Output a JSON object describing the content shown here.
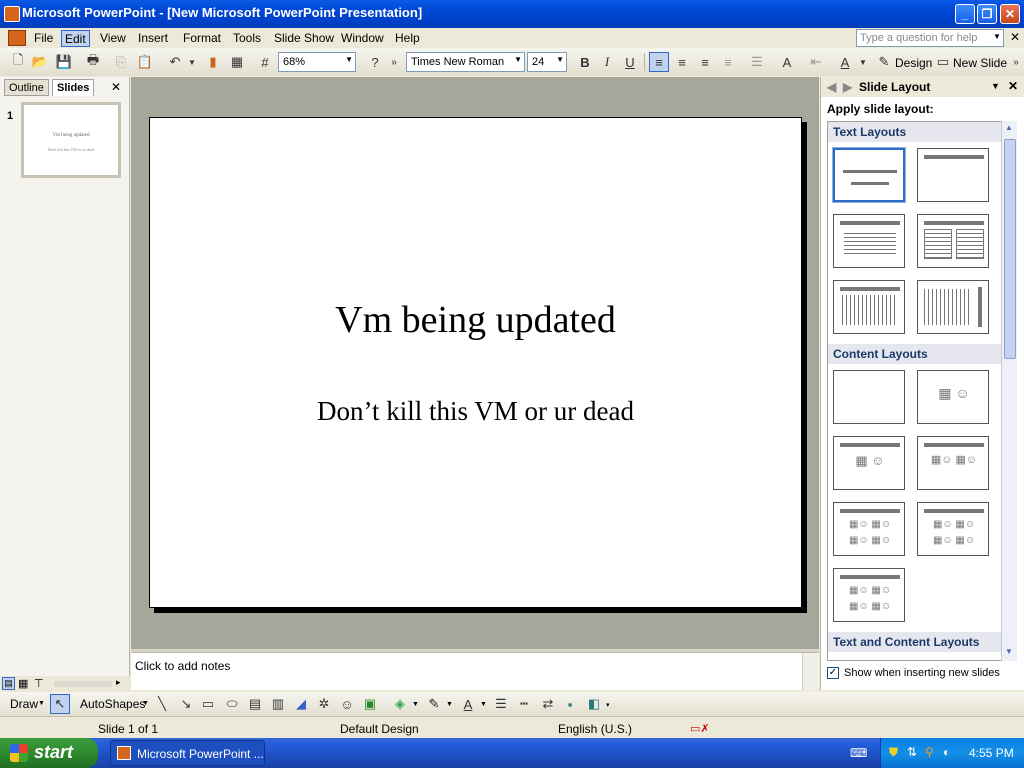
{
  "window": {
    "title": "Microsoft PowerPoint - [New Microsoft PowerPoint Presentation]"
  },
  "menu": {
    "items": [
      "File",
      "Edit",
      "View",
      "Insert",
      "Format",
      "Tools",
      "Slide Show",
      "Window",
      "Help"
    ],
    "active": "Edit",
    "help_placeholder": "Type a question for help"
  },
  "toolbar": {
    "zoom": "68%",
    "font": "Times New Roman",
    "size": "24",
    "bold": "B",
    "italic": "I",
    "underline": "U",
    "design": "Design",
    "new_slide": "New Slide"
  },
  "leftpane": {
    "tabs": [
      "Outline",
      "Slides"
    ],
    "active_tab": "Slides",
    "slide_number": "1",
    "thumb_title": "Vm being updated",
    "thumb_sub": "Don't kill this VM or ur dead"
  },
  "slide": {
    "title": "Vm being updated",
    "subtitle": "Don’t kill this VM or ur dead"
  },
  "notes": {
    "placeholder": "Click to add notes"
  },
  "taskpane": {
    "header": "Slide Layout",
    "apply_label": "Apply slide layout:",
    "sections": [
      "Text Layouts",
      "Content Layouts",
      "Text and Content Layouts"
    ],
    "show_check": "Show when inserting new slides"
  },
  "drawbar": {
    "draw": "Draw",
    "autoshapes": "AutoShapes"
  },
  "status": {
    "slide": "Slide 1 of 1",
    "design": "Default Design",
    "language": "English (U.S.)"
  },
  "taskbar": {
    "start": "start",
    "item": "Microsoft PowerPoint ...",
    "clock": "4:55 PM"
  },
  "colors": {
    "titlebar": "#0046d5",
    "slide_bg": "#a6a69a",
    "start_green": "#2f8a2f"
  }
}
